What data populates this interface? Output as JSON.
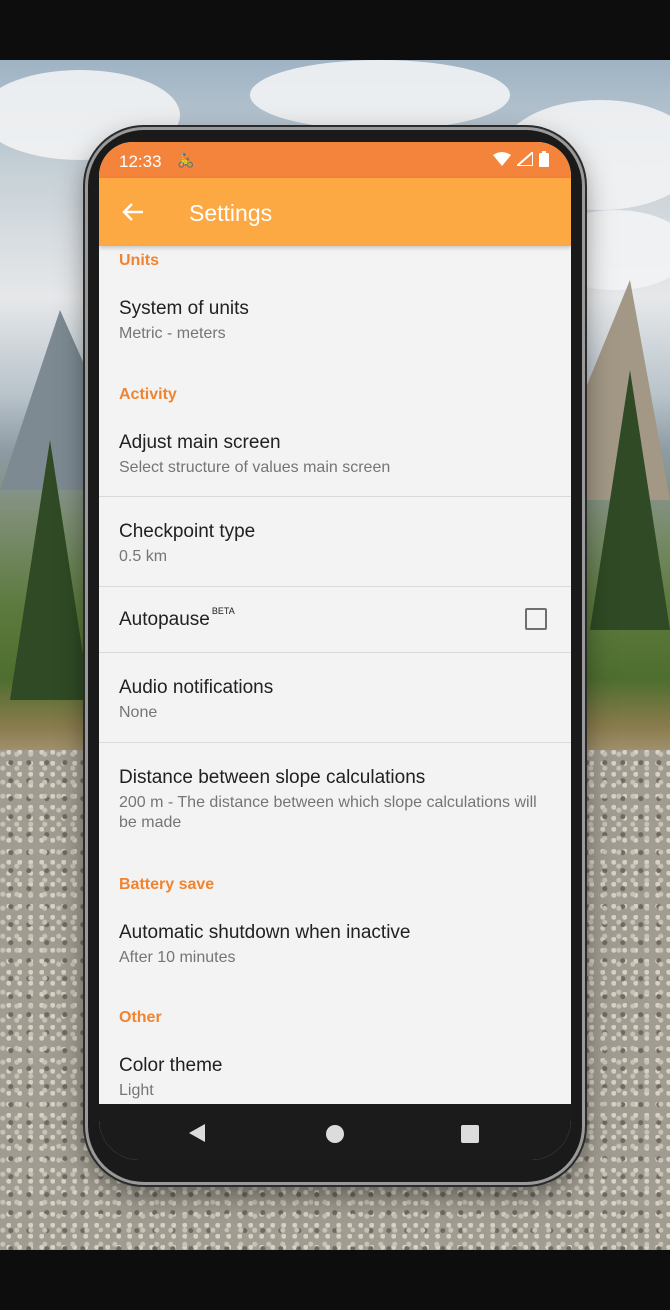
{
  "status_bar": {
    "time": "12:33",
    "app_icon": "bicycle-icon"
  },
  "app_bar": {
    "title": "Settings",
    "back_icon": "arrow-left-icon"
  },
  "sections": {
    "units": {
      "header": "Units"
    },
    "activity": {
      "header": "Activity"
    },
    "battery": {
      "header": "Battery save"
    },
    "other": {
      "header": "Other"
    }
  },
  "prefs": {
    "system_of_units": {
      "title": "System of units",
      "summary": "Metric - meters"
    },
    "adjust_main_screen": {
      "title": "Adjust main screen",
      "summary": "Select structure of values main screen"
    },
    "checkpoint_type": {
      "title": "Checkpoint type",
      "summary": "0.5 km"
    },
    "autopause": {
      "title": "Autopause",
      "badge": "BETA",
      "checked": false
    },
    "audio_notifications": {
      "title": "Audio notifications",
      "summary": "None"
    },
    "slope_distance": {
      "title": "Distance between slope calculations",
      "summary": "200 m - The distance between which slope calculations will be made"
    },
    "auto_shutdown": {
      "title": "Automatic shutdown when inactive",
      "summary": "After 10 minutes"
    },
    "color_theme": {
      "title": "Color theme",
      "summary": "Light"
    }
  },
  "colors": {
    "status_bar": "#f4843c",
    "app_bar": "#fca943",
    "accent": "#f08431"
  }
}
